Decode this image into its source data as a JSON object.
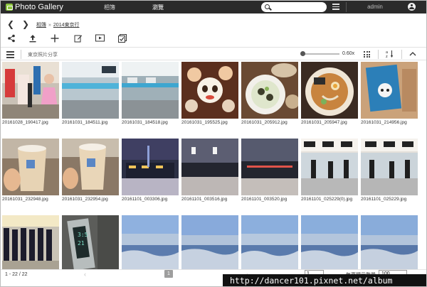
{
  "header": {
    "app_title": "Photo Gallery",
    "nav_tabs": [
      {
        "label": "相簿"
      },
      {
        "label": "瀏覽"
      }
    ],
    "search": {
      "value": "",
      "placeholder": ""
    },
    "user": "admin"
  },
  "breadcrumb": {
    "root": "相簿",
    "separator": "»",
    "current": "2014東京行"
  },
  "toolbar": {
    "icons": [
      "share-icon",
      "upload-icon",
      "add-icon",
      "edit-icon",
      "slideshow-icon",
      "select-all-icon"
    ]
  },
  "subbar": {
    "album_name": "東京照片分享",
    "zoom_value": 0.6,
    "zoom_label": "0.60x"
  },
  "photos": [
    {
      "filename": "20161028_190417.jpg"
    },
    {
      "filename": "20161031_184511.jpg"
    },
    {
      "filename": "20161031_184518.jpg"
    },
    {
      "filename": "20161031_195525.jpg"
    },
    {
      "filename": "20161031_205912.jpg"
    },
    {
      "filename": "20161031_205947.jpg"
    },
    {
      "filename": "20161031_214956.jpg"
    },
    {
      "filename": "20161031_232948.jpg"
    },
    {
      "filename": "20161031_232954.jpg"
    },
    {
      "filename": "20161101_003306.jpg"
    },
    {
      "filename": "20161101_003516.jpg"
    },
    {
      "filename": "20161101_003520.jpg"
    },
    {
      "filename": "20161101_025229(0).jpg"
    },
    {
      "filename": "20161101_025229.jpg"
    },
    {
      "filename": ""
    },
    {
      "filename": ""
    },
    {
      "filename": ""
    },
    {
      "filename": ""
    },
    {
      "filename": ""
    },
    {
      "filename": ""
    },
    {
      "filename": ""
    }
  ],
  "footer": {
    "count": "1 - 22 / 22",
    "prev": "‹",
    "current_page": "1",
    "next": "›",
    "page_input": "1",
    "per_page_label": "每頁顯示數量",
    "per_page_value": "100"
  },
  "watermark": "http://dancer101.pixnet.net/album"
}
